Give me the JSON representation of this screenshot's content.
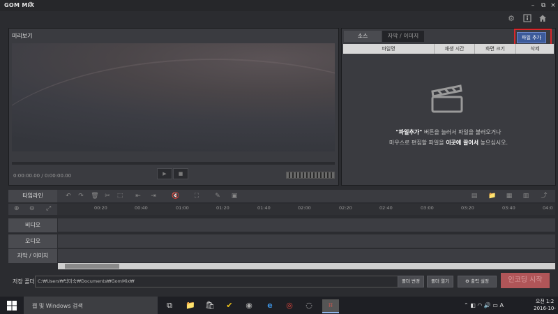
{
  "app": {
    "title": "GOM MIX"
  },
  "window": {
    "minimize": "–",
    "restore": "⧉",
    "close": "×"
  },
  "top_icons": [
    "gear-icon",
    "info-icon",
    "home-icon"
  ],
  "preview": {
    "title": "미리보기",
    "time_current": "0:00:00.00",
    "time_separator": "/",
    "time_total": "0:00:00.00"
  },
  "source": {
    "tabs": [
      {
        "label": "소스"
      },
      {
        "label": "자막 / 이미지"
      }
    ],
    "add_file_label": "파일 추가",
    "columns": [
      "파일명",
      "재생 시간",
      "화면 크기",
      "삭제"
    ],
    "hint_quote": "\"파일추가\"",
    "hint_line1_rest": " 버튼을 눌러서 파일을 불러오거나",
    "hint_line2_pre": "마우스로 편집할 파일을 ",
    "hint_line2_bold": "이곳에 끌어서",
    "hint_line2_post": " 놓으십시오."
  },
  "timeline": {
    "label": "타임라인",
    "ticks": [
      "00:20",
      "00:40",
      "01:00",
      "01:20",
      "01:40",
      "02:00",
      "02:20",
      "02:40",
      "03:00",
      "03:20",
      "03:40",
      "04:0"
    ],
    "tracks": [
      "비디오",
      "오디오",
      "자막 / 이미지"
    ]
  },
  "bottom": {
    "save_label": "저장 폴더",
    "save_path": "C:₩Users₩박미숙₩Documents₩GomMix₩",
    "change_folder": "폴더 변경",
    "open_folder": "폴더 열기",
    "output_settings": "출력 설정",
    "encode_start": "인코딩 시작"
  },
  "taskbar": {
    "search_placeholder": "웹 및 Windows 검색",
    "clock_time": "오전 1:2",
    "clock_date": "2016-10-",
    "ime": "A"
  },
  "colors": {
    "accent": "#3c5a9a",
    "highlight": "#d9272b",
    "encode": "#b05558"
  }
}
